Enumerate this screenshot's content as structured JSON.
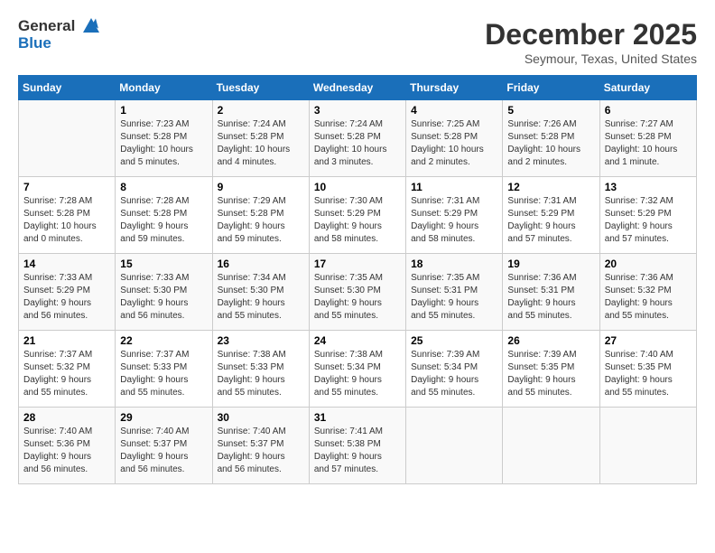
{
  "header": {
    "logo_line1": "General",
    "logo_line2": "Blue",
    "main_title": "December 2025",
    "subtitle": "Seymour, Texas, United States"
  },
  "calendar": {
    "days_of_week": [
      "Sunday",
      "Monday",
      "Tuesday",
      "Wednesday",
      "Thursday",
      "Friday",
      "Saturday"
    ],
    "weeks": [
      [
        {
          "day": "",
          "info": ""
        },
        {
          "day": "1",
          "info": "Sunrise: 7:23 AM\nSunset: 5:28 PM\nDaylight: 10 hours\nand 5 minutes."
        },
        {
          "day": "2",
          "info": "Sunrise: 7:24 AM\nSunset: 5:28 PM\nDaylight: 10 hours\nand 4 minutes."
        },
        {
          "day": "3",
          "info": "Sunrise: 7:24 AM\nSunset: 5:28 PM\nDaylight: 10 hours\nand 3 minutes."
        },
        {
          "day": "4",
          "info": "Sunrise: 7:25 AM\nSunset: 5:28 PM\nDaylight: 10 hours\nand 2 minutes."
        },
        {
          "day": "5",
          "info": "Sunrise: 7:26 AM\nSunset: 5:28 PM\nDaylight: 10 hours\nand 2 minutes."
        },
        {
          "day": "6",
          "info": "Sunrise: 7:27 AM\nSunset: 5:28 PM\nDaylight: 10 hours\nand 1 minute."
        }
      ],
      [
        {
          "day": "7",
          "info": "Sunrise: 7:28 AM\nSunset: 5:28 PM\nDaylight: 10 hours\nand 0 minutes."
        },
        {
          "day": "8",
          "info": "Sunrise: 7:28 AM\nSunset: 5:28 PM\nDaylight: 9 hours\nand 59 minutes."
        },
        {
          "day": "9",
          "info": "Sunrise: 7:29 AM\nSunset: 5:28 PM\nDaylight: 9 hours\nand 59 minutes."
        },
        {
          "day": "10",
          "info": "Sunrise: 7:30 AM\nSunset: 5:29 PM\nDaylight: 9 hours\nand 58 minutes."
        },
        {
          "day": "11",
          "info": "Sunrise: 7:31 AM\nSunset: 5:29 PM\nDaylight: 9 hours\nand 58 minutes."
        },
        {
          "day": "12",
          "info": "Sunrise: 7:31 AM\nSunset: 5:29 PM\nDaylight: 9 hours\nand 57 minutes."
        },
        {
          "day": "13",
          "info": "Sunrise: 7:32 AM\nSunset: 5:29 PM\nDaylight: 9 hours\nand 57 minutes."
        }
      ],
      [
        {
          "day": "14",
          "info": "Sunrise: 7:33 AM\nSunset: 5:29 PM\nDaylight: 9 hours\nand 56 minutes."
        },
        {
          "day": "15",
          "info": "Sunrise: 7:33 AM\nSunset: 5:30 PM\nDaylight: 9 hours\nand 56 minutes."
        },
        {
          "day": "16",
          "info": "Sunrise: 7:34 AM\nSunset: 5:30 PM\nDaylight: 9 hours\nand 55 minutes."
        },
        {
          "day": "17",
          "info": "Sunrise: 7:35 AM\nSunset: 5:30 PM\nDaylight: 9 hours\nand 55 minutes."
        },
        {
          "day": "18",
          "info": "Sunrise: 7:35 AM\nSunset: 5:31 PM\nDaylight: 9 hours\nand 55 minutes."
        },
        {
          "day": "19",
          "info": "Sunrise: 7:36 AM\nSunset: 5:31 PM\nDaylight: 9 hours\nand 55 minutes."
        },
        {
          "day": "20",
          "info": "Sunrise: 7:36 AM\nSunset: 5:32 PM\nDaylight: 9 hours\nand 55 minutes."
        }
      ],
      [
        {
          "day": "21",
          "info": "Sunrise: 7:37 AM\nSunset: 5:32 PM\nDaylight: 9 hours\nand 55 minutes."
        },
        {
          "day": "22",
          "info": "Sunrise: 7:37 AM\nSunset: 5:33 PM\nDaylight: 9 hours\nand 55 minutes."
        },
        {
          "day": "23",
          "info": "Sunrise: 7:38 AM\nSunset: 5:33 PM\nDaylight: 9 hours\nand 55 minutes."
        },
        {
          "day": "24",
          "info": "Sunrise: 7:38 AM\nSunset: 5:34 PM\nDaylight: 9 hours\nand 55 minutes."
        },
        {
          "day": "25",
          "info": "Sunrise: 7:39 AM\nSunset: 5:34 PM\nDaylight: 9 hours\nand 55 minutes."
        },
        {
          "day": "26",
          "info": "Sunrise: 7:39 AM\nSunset: 5:35 PM\nDaylight: 9 hours\nand 55 minutes."
        },
        {
          "day": "27",
          "info": "Sunrise: 7:40 AM\nSunset: 5:35 PM\nDaylight: 9 hours\nand 55 minutes."
        }
      ],
      [
        {
          "day": "28",
          "info": "Sunrise: 7:40 AM\nSunset: 5:36 PM\nDaylight: 9 hours\nand 56 minutes."
        },
        {
          "day": "29",
          "info": "Sunrise: 7:40 AM\nSunset: 5:37 PM\nDaylight: 9 hours\nand 56 minutes."
        },
        {
          "day": "30",
          "info": "Sunrise: 7:40 AM\nSunset: 5:37 PM\nDaylight: 9 hours\nand 56 minutes."
        },
        {
          "day": "31",
          "info": "Sunrise: 7:41 AM\nSunset: 5:38 PM\nDaylight: 9 hours\nand 57 minutes."
        },
        {
          "day": "",
          "info": ""
        },
        {
          "day": "",
          "info": ""
        },
        {
          "day": "",
          "info": ""
        }
      ]
    ]
  }
}
